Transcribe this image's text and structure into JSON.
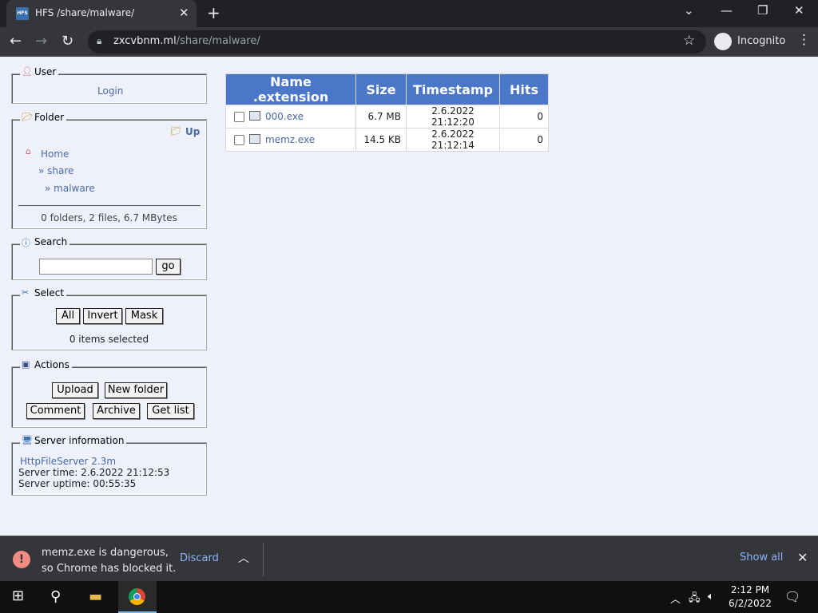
{
  "browser": {
    "tab_title": "HFS /share/malware/",
    "favicon_text": "HFS",
    "url_host": "zxcvbnm.ml",
    "url_path": "/share/malware/",
    "incognito_label": "Incognito"
  },
  "sidebar": {
    "user": {
      "legend": "User",
      "login": "Login"
    },
    "folder": {
      "legend": "Folder",
      "up": "Up",
      "home": "Home",
      "crumb1": "» share",
      "crumb2": "» malware",
      "summary": "0 folders, 2 files, 6.7 MBytes"
    },
    "search": {
      "legend": "Search",
      "go": "go"
    },
    "select": {
      "legend": "Select",
      "all": "All",
      "invert": "Invert",
      "mask": "Mask",
      "count": "0 items selected"
    },
    "actions": {
      "legend": "Actions",
      "upload": "Upload",
      "new_folder": "New folder",
      "comment": "Comment",
      "archive": "Archive",
      "get_list": "Get list"
    },
    "server": {
      "legend": "Server information",
      "version": "HttpFileServer 2.3m",
      "time": "Server time: 2.6.2022 21:12:53",
      "uptime": "Server uptime: 00:55:35"
    }
  },
  "files": {
    "headers": {
      "name": "Name .extension",
      "size": "Size",
      "timestamp": "Timestamp",
      "hits": "Hits"
    },
    "rows": [
      {
        "name": "000.exe",
        "size": "6.7 MB",
        "timestamp": "2.6.2022 21:12:20",
        "hits": "0"
      },
      {
        "name": "memz.exe",
        "size": "14.5 KB",
        "timestamp": "2.6.2022 21:12:14",
        "hits": "0"
      }
    ]
  },
  "download_bar": {
    "line1": "memz.exe is dangerous,",
    "line2": "so Chrome has blocked it.",
    "discard": "Discard",
    "show_all": "Show all"
  },
  "taskbar": {
    "time": "2:12 PM",
    "date": "6/2/2022"
  },
  "colors": {
    "header_blue": "#4a77c8",
    "link": "#4a6aa8",
    "error": "#f28b82"
  }
}
